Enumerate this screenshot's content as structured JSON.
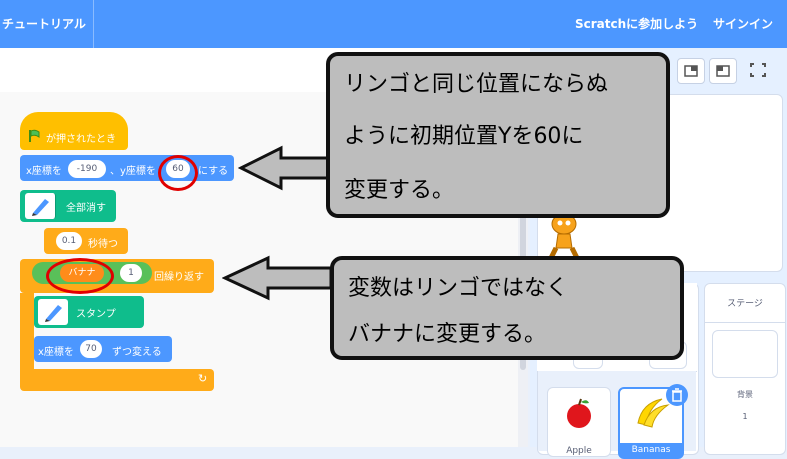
{
  "topbar": {
    "tutorial": "チュートリアル",
    "join": "Scratchに参加しよう",
    "signin": "サインイン"
  },
  "blocks": {
    "hat": "が押されたとき",
    "goto_prefix": "x座標を",
    "goto_x": "-190",
    "goto_mid": "、y座標を",
    "goto_y": "60",
    "goto_suffix": "にする",
    "clear": "全部消す",
    "wait_value": "0.1",
    "wait_label": "秒待つ",
    "repeat_var": "バナナ",
    "repeat_op": "-",
    "repeat_value": "1",
    "repeat_label": "回繰り返す",
    "stamp": "スタンプ",
    "change_prefix": "x座標を",
    "change_value": "70",
    "change_suffix": "ずつ変える",
    "loop_arrow": "↻"
  },
  "callouts": {
    "top_lines": [
      "リンゴと同じ位置にならぬ",
      "ように初期位置Yを60に",
      "変更する。"
    ],
    "bottom_lines": [
      "変数はリンゴではなく",
      "バナナに変更する。"
    ]
  },
  "sprites": {
    "items": [
      {
        "name": "Apple"
      },
      {
        "name": "Bananas"
      }
    ]
  },
  "stage_pane": {
    "title": "ステージ",
    "backdrops_label": "背景",
    "backdrops_count": "1"
  },
  "colors": {
    "motion": "#4c97ff",
    "control": "#ffab19",
    "events": "#ffbf00",
    "pen": "#0fbd8c",
    "variable": "#ff8c1a",
    "callout_bg": "#bdbdbd",
    "highlight": "#e00000"
  }
}
